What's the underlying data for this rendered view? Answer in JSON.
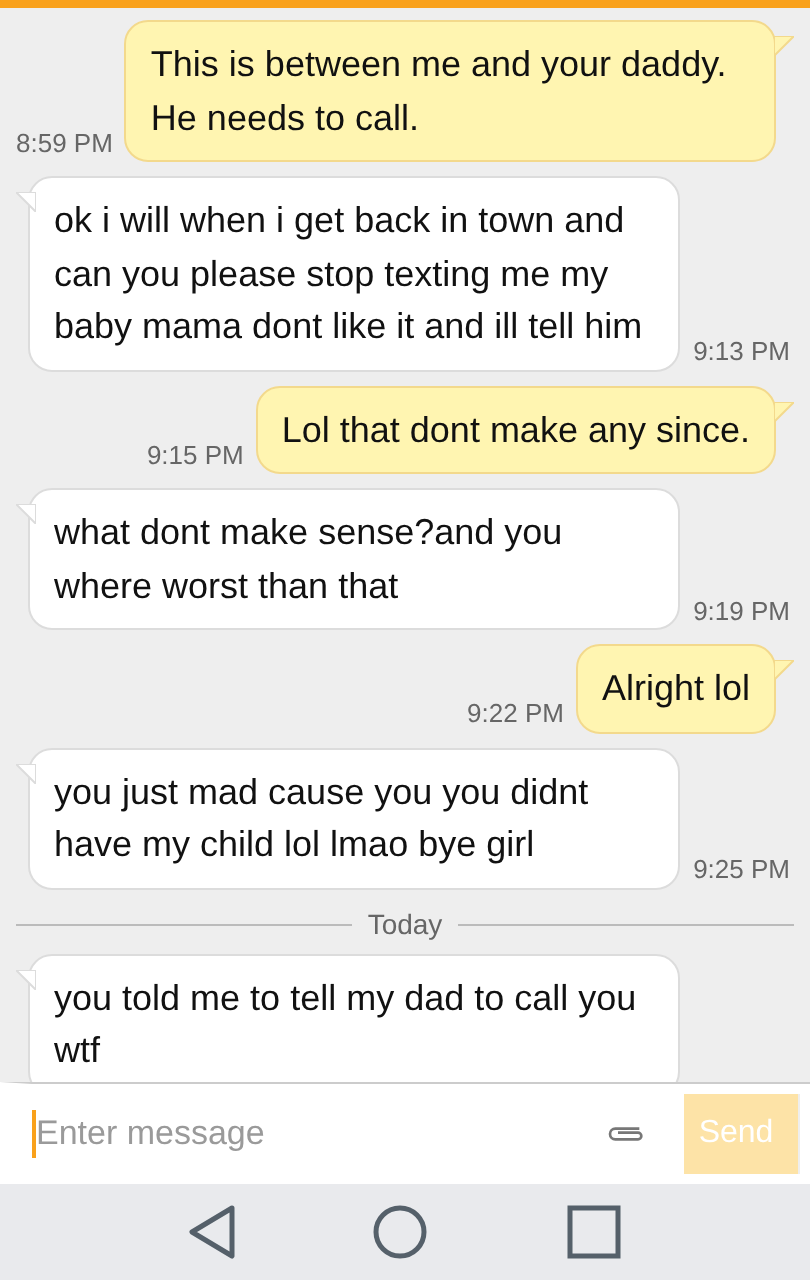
{
  "messages": [
    {
      "kind": "sent",
      "text": "This is between me and your daddy. He needs to call.",
      "time": "8:59 PM"
    },
    {
      "kind": "received",
      "text": "ok i will when i get back in town and can you please stop texting me my baby mama dont like it and ill tell him",
      "time": "9:13 PM"
    },
    {
      "kind": "sent",
      "text": "Lol that dont make any since.",
      "time": "9:15 PM"
    },
    {
      "kind": "received",
      "text": "what dont make sense?and you where worst than that",
      "time": "9:19 PM"
    },
    {
      "kind": "sent",
      "text": "Alright lol",
      "time": "9:22 PM"
    },
    {
      "kind": "received",
      "text": "you just mad cause you you didnt have my child lol lmao bye girl",
      "time": "9:25 PM"
    },
    {
      "kind": "divider",
      "text": "Today"
    },
    {
      "kind": "received",
      "text": "you told me to tell my dad to call you wtf"
    }
  ],
  "composer": {
    "placeholder": "Enter message",
    "send_button": {
      "label": "Send",
      "disabled": true
    }
  }
}
